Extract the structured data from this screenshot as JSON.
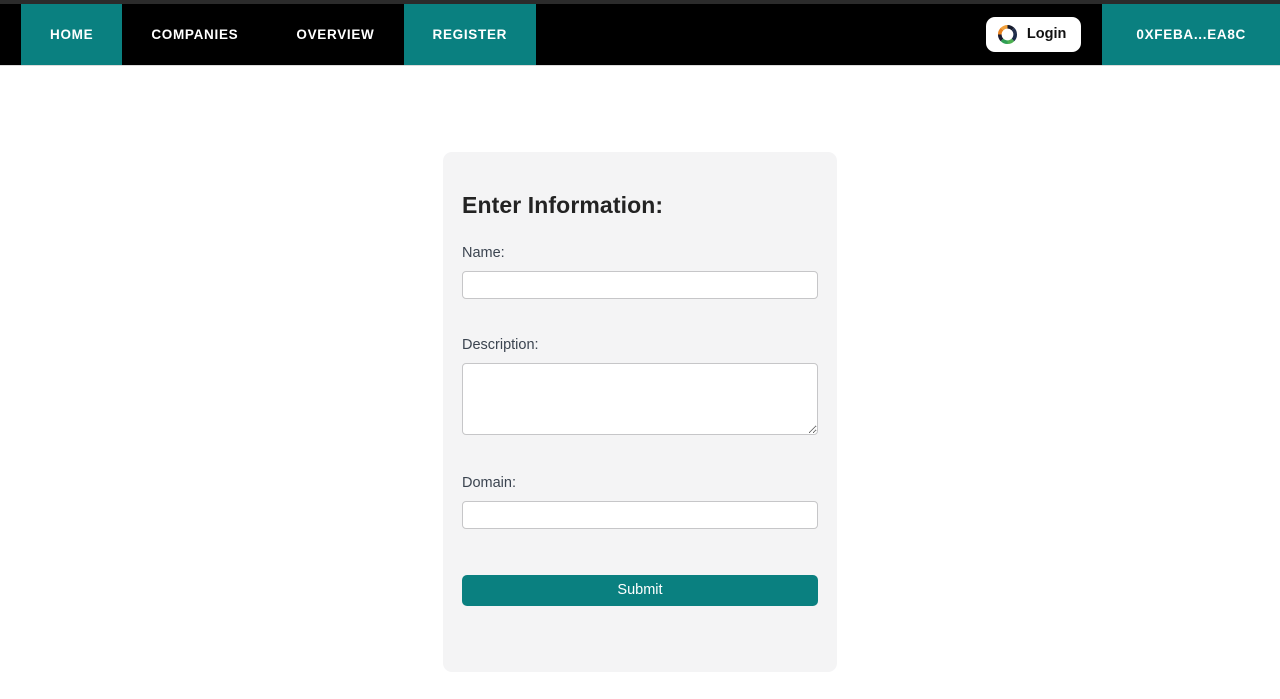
{
  "navbar": {
    "items": [
      {
        "label": "HOME",
        "active": true
      },
      {
        "label": "COMPANIES",
        "active": false
      },
      {
        "label": "OVERVIEW",
        "active": false
      },
      {
        "label": "REGISTER",
        "active": true
      }
    ],
    "login_button": {
      "label": "Login",
      "icon": "segmented-ring-icon"
    },
    "wallet": {
      "address": "0XFEBA...EA8C"
    }
  },
  "form": {
    "title": "Enter Information:",
    "fields": [
      {
        "label": "Name:",
        "value": "",
        "placeholder": "",
        "type": "text"
      },
      {
        "label": "Description:",
        "value": "",
        "placeholder": "",
        "type": "textarea"
      },
      {
        "label": "Domain:",
        "value": "",
        "placeholder": "",
        "type": "text"
      }
    ],
    "submit_label": "Submit"
  },
  "colors": {
    "accent_teal": "#0a8080",
    "navbar_black": "#000000",
    "card_background": "#f4f4f5",
    "label_text": "#3b4450"
  }
}
